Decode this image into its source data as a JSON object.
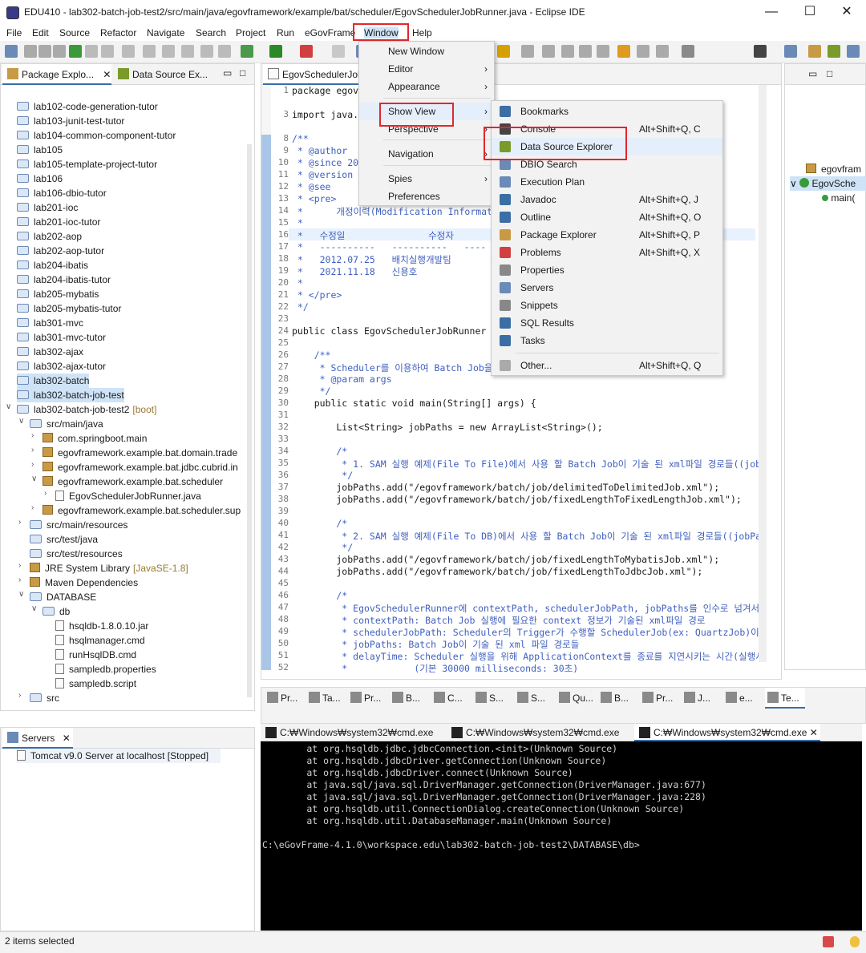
{
  "window": {
    "title": "EDU410 - lab302-batch-job-test2/src/main/java/egovframework/example/bat/scheduler/EgovSchedulerJobRunner.java - Eclipse IDE"
  },
  "menubar": [
    "File",
    "Edit",
    "Source",
    "Refactor",
    "Navigate",
    "Search",
    "Project",
    "Run",
    "eGovFrame",
    "Window",
    "Help"
  ],
  "explorer": {
    "tabs": [
      "Package Explo...",
      "Data Source Ex..."
    ],
    "rows": [
      {
        "label": "lab102-code-generation-tutor",
        "kind": "folder",
        "indent": 0
      },
      {
        "label": "lab103-junit-test-tutor",
        "kind": "folder",
        "indent": 0
      },
      {
        "label": "lab104-common-component-tutor",
        "kind": "folder",
        "indent": 0
      },
      {
        "label": "lab105",
        "kind": "folder",
        "indent": 0
      },
      {
        "label": "lab105-template-project-tutor",
        "kind": "folder",
        "indent": 0
      },
      {
        "label": "lab106",
        "kind": "folder",
        "indent": 0
      },
      {
        "label": "lab106-dbio-tutor",
        "kind": "folder",
        "indent": 0
      },
      {
        "label": "lab201-ioc",
        "kind": "folder",
        "indent": 0
      },
      {
        "label": "lab201-ioc-tutor",
        "kind": "folder",
        "indent": 0
      },
      {
        "label": "lab202-aop",
        "kind": "folder",
        "indent": 0
      },
      {
        "label": "lab202-aop-tutor",
        "kind": "folder",
        "indent": 0
      },
      {
        "label": "lab204-ibatis",
        "kind": "folder",
        "indent": 0
      },
      {
        "label": "lab204-ibatis-tutor",
        "kind": "folder",
        "indent": 0
      },
      {
        "label": "lab205-mybatis",
        "kind": "folder",
        "indent": 0
      },
      {
        "label": "lab205-mybatis-tutor",
        "kind": "folder",
        "indent": 0
      },
      {
        "label": "lab301-mvc",
        "kind": "folder",
        "indent": 0
      },
      {
        "label": "lab301-mvc-tutor",
        "kind": "folder",
        "indent": 0
      },
      {
        "label": "lab302-ajax",
        "kind": "folder",
        "indent": 0
      },
      {
        "label": "lab302-ajax-tutor",
        "kind": "folder",
        "indent": 0
      },
      {
        "label": "lab302-batch",
        "kind": "folder",
        "indent": 0,
        "selected": true
      },
      {
        "label": "lab302-batch-job-test",
        "kind": "folder",
        "indent": 0,
        "selected": true
      },
      {
        "label": "lab302-batch-job-test2",
        "kind": "folder",
        "indent": 0,
        "chev": "v",
        "suffix": "[boot]"
      },
      {
        "label": "src/main/java",
        "kind": "folder",
        "indent": 1,
        "chev": "v"
      },
      {
        "label": "com.springboot.main",
        "kind": "pkg",
        "indent": 2,
        "chev": ">"
      },
      {
        "label": "egovframework.example.bat.domain.trade",
        "kind": "pkg",
        "indent": 2,
        "chev": ">"
      },
      {
        "label": "egovframework.example.bat.jdbc.cubrid.in",
        "kind": "pkg",
        "indent": 2,
        "chev": ">"
      },
      {
        "label": "egovframework.example.bat.scheduler",
        "kind": "pkg",
        "indent": 2,
        "chev": "v"
      },
      {
        "label": "EgovSchedulerJobRunner.java",
        "kind": "file",
        "indent": 3,
        "chev": ">"
      },
      {
        "label": "egovframework.example.bat.scheduler.sup",
        "kind": "pkg",
        "indent": 2,
        "chev": ">"
      },
      {
        "label": "src/main/resources",
        "kind": "folder",
        "indent": 1,
        "chev": ">"
      },
      {
        "label": "src/test/java",
        "kind": "folder",
        "indent": 1
      },
      {
        "label": "src/test/resources",
        "kind": "folder",
        "indent": 1
      },
      {
        "label": "JRE System Library",
        "kind": "pkg",
        "indent": 1,
        "chev": ">",
        "suffix": "[JavaSE-1.8]"
      },
      {
        "label": "Maven Dependencies",
        "kind": "pkg",
        "indent": 1,
        "chev": ">"
      },
      {
        "label": "DATABASE",
        "kind": "folder",
        "indent": 1,
        "chev": "v"
      },
      {
        "label": "db",
        "kind": "folder",
        "indent": 2,
        "chev": "v"
      },
      {
        "label": "hsqldb-1.8.0.10.jar",
        "kind": "file",
        "indent": 3
      },
      {
        "label": "hsqlmanager.cmd",
        "kind": "file",
        "indent": 3
      },
      {
        "label": "runHsqlDB.cmd",
        "kind": "file",
        "indent": 3
      },
      {
        "label": "sampledb.properties",
        "kind": "file",
        "indent": 3
      },
      {
        "label": "sampledb.script",
        "kind": "file",
        "indent": 3
      },
      {
        "label": "src",
        "kind": "folder",
        "indent": 1,
        "chev": ">"
      }
    ]
  },
  "servers": {
    "tab": "Servers",
    "item": "Tomcat v9.0 Server at localhost",
    "state": "[Stopped]"
  },
  "editor": {
    "tab": "EgovSchedulerJob",
    "lines": [
      {
        "n": "1",
        "t": "package egov"
      },
      {
        "n": "3",
        "t": "import java."
      },
      {
        "n": "8",
        "t": "/**"
      },
      {
        "n": "9",
        "t": " * @author"
      },
      {
        "n": "10",
        "t": " * @since 20"
      },
      {
        "n": "11",
        "t": " * @version"
      },
      {
        "n": "12",
        "t": " * @see"
      },
      {
        "n": "13",
        "t": " * <pre>"
      },
      {
        "n": "14",
        "t": " *      개정이력(Modification Informat"
      },
      {
        "n": "15",
        "t": " *"
      },
      {
        "n": "16",
        "t": " *   수정일               수정자"
      },
      {
        "n": "17",
        "t": " *   ----------   ----------   ----"
      },
      {
        "n": "18",
        "t": " *   2012.07.25   배치실행개발팀       최"
      },
      {
        "n": "19",
        "t": " *   2021.11.18   신용호"
      },
      {
        "n": "20",
        "t": " *"
      },
      {
        "n": "21",
        "t": " * </pre>"
      },
      {
        "n": "22",
        "t": " */"
      },
      {
        "n": "23",
        "t": ""
      },
      {
        "n": "24",
        "t": "public class EgovSchedulerJobRunner"
      },
      {
        "n": "25",
        "t": ""
      },
      {
        "n": "26",
        "t": "    /**"
      },
      {
        "n": "27",
        "t": "     * Scheduler를 이용하여 Batch Job을"
      },
      {
        "n": "28",
        "t": "     * @param args"
      },
      {
        "n": "29",
        "t": "     */"
      },
      {
        "n": "30",
        "t": "    public static void main(String[] args) {"
      },
      {
        "n": "31",
        "t": ""
      },
      {
        "n": "32",
        "t": "        List<String> jobPaths = new ArrayList<String>();"
      },
      {
        "n": "33",
        "t": ""
      },
      {
        "n": "34",
        "t": "        /*"
      },
      {
        "n": "35",
        "t": "         * 1. SAM 실행 예제(File To File)에서 사용 할 Batch Job이 기술 된 xml파일 경로들((job"
      },
      {
        "n": "36",
        "t": "         */"
      },
      {
        "n": "37",
        "t": "        jobPaths.add(\"/egovframework/batch/job/delimitedToDelimitedJob.xml\");"
      },
      {
        "n": "38",
        "t": "        jobPaths.add(\"/egovframework/batch/job/fixedLengthToFixedLengthJob.xml\");"
      },
      {
        "n": "39",
        "t": ""
      },
      {
        "n": "40",
        "t": "        /*"
      },
      {
        "n": "41",
        "t": "         * 2. SAM 실행 예제(File To DB)에서 사용 할 Batch Job이 기술 된 xml파일 경로들((jobPa"
      },
      {
        "n": "42",
        "t": "         */"
      },
      {
        "n": "43",
        "t": "        jobPaths.add(\"/egovframework/batch/job/fixedLengthToMybatisJob.xml\");"
      },
      {
        "n": "44",
        "t": "        jobPaths.add(\"/egovframework/batch/job/fixedLengthToJdbcJob.xml\");"
      },
      {
        "n": "45",
        "t": ""
      },
      {
        "n": "46",
        "t": "        /*"
      },
      {
        "n": "47",
        "t": "         * EgovSchedulerRunner에 contextPath, schedulerJobPath, jobPaths를 인수로 넘겨서"
      },
      {
        "n": "48",
        "t": "         * contextPath: Batch Job 실행에 필요한 context 정보가 기술된 xml파일 경로"
      },
      {
        "n": "49",
        "t": "         * schedulerJobPath: Scheduler의 Trigger가 수행할 SchedulerJob(ex: QuartzJob)이"
      },
      {
        "n": "50",
        "t": "         * jobPaths: Batch Job이 기술 된 xml 파일 경로들"
      },
      {
        "n": "51",
        "t": "         * delayTime: Scheduler 실행을 위해 ApplicationContext를 종료를 지연시키는 시간(실행시"
      },
      {
        "n": "52",
        "t": "         *            (기본 30000 milliseconds: 30초)"
      }
    ]
  },
  "window_menu": {
    "items": [
      {
        "label": "New Window"
      },
      {
        "label": "Editor",
        "arrow": true
      },
      {
        "label": "Appearance",
        "arrow": true
      },
      {
        "label": "Show View",
        "arrow": true,
        "hover": true
      },
      {
        "label": "Perspective",
        "arrow": true
      },
      {
        "label": "Navigation",
        "arrow": true
      },
      {
        "label": "Spies",
        "arrow": true
      },
      {
        "label": "Preferences"
      }
    ]
  },
  "showview_menu": {
    "items": [
      {
        "label": "Bookmarks",
        "shortcut": ""
      },
      {
        "label": "Console",
        "shortcut": "Alt+Shift+Q, C"
      },
      {
        "label": "Data Source Explorer",
        "shortcut": "",
        "hover": true
      },
      {
        "label": "DBIO Search",
        "shortcut": ""
      },
      {
        "label": "Execution Plan",
        "shortcut": ""
      },
      {
        "label": "Javadoc",
        "shortcut": "Alt+Shift+Q, J"
      },
      {
        "label": "Outline",
        "shortcut": "Alt+Shift+Q, O"
      },
      {
        "label": "Package Explorer",
        "shortcut": "Alt+Shift+Q, P"
      },
      {
        "label": "Problems",
        "shortcut": "Alt+Shift+Q, X"
      },
      {
        "label": "Properties",
        "shortcut": ""
      },
      {
        "label": "Servers",
        "shortcut": ""
      },
      {
        "label": "Snippets",
        "shortcut": ""
      },
      {
        "label": "SQL Results",
        "shortcut": ""
      },
      {
        "label": "Tasks",
        "shortcut": ""
      },
      {
        "label": "Other...",
        "shortcut": "Alt+Shift+Q, Q"
      }
    ]
  },
  "outline": {
    "items": [
      "egovfram",
      "EgovSche",
      "main("
    ]
  },
  "bottom_tabs": [
    "Pr...",
    "Ta...",
    "Pr...",
    "B...",
    "C...",
    "S...",
    "S...",
    "Qu...",
    "B...",
    "Pr...",
    "J...",
    "e...",
    "Te..."
  ],
  "console": {
    "tabs": [
      "C:₩Windows₩system32₩cmd.exe",
      "C:₩Windows₩system32₩cmd.exe",
      "C:₩Windows₩system32₩cmd.exe"
    ],
    "text": "        at org.hsqldb.jdbc.jdbcConnection.<init>(Unknown Source)\n        at org.hsqldb.jdbcDriver.getConnection(Unknown Source)\n        at org.hsqldb.jdbcDriver.connect(Unknown Source)\n        at java.sql/java.sql.DriverManager.getConnection(DriverManager.java:677)\n        at java.sql/java.sql.DriverManager.getConnection(DriverManager.java:228)\n        at org.hsqldb.util.ConnectionDialog.createConnection(Unknown Source)\n        at org.hsqldb.util.DatabaseManager.main(Unknown Source)\n\nC:\\eGovFrame-4.1.0\\workspace.edu\\lab302-batch-job-test2\\DATABASE\\db>"
  },
  "status": {
    "text": "2 items selected"
  },
  "colors": {
    "accent": "#3a6ea5",
    "highlight_box": "#e3262d"
  }
}
